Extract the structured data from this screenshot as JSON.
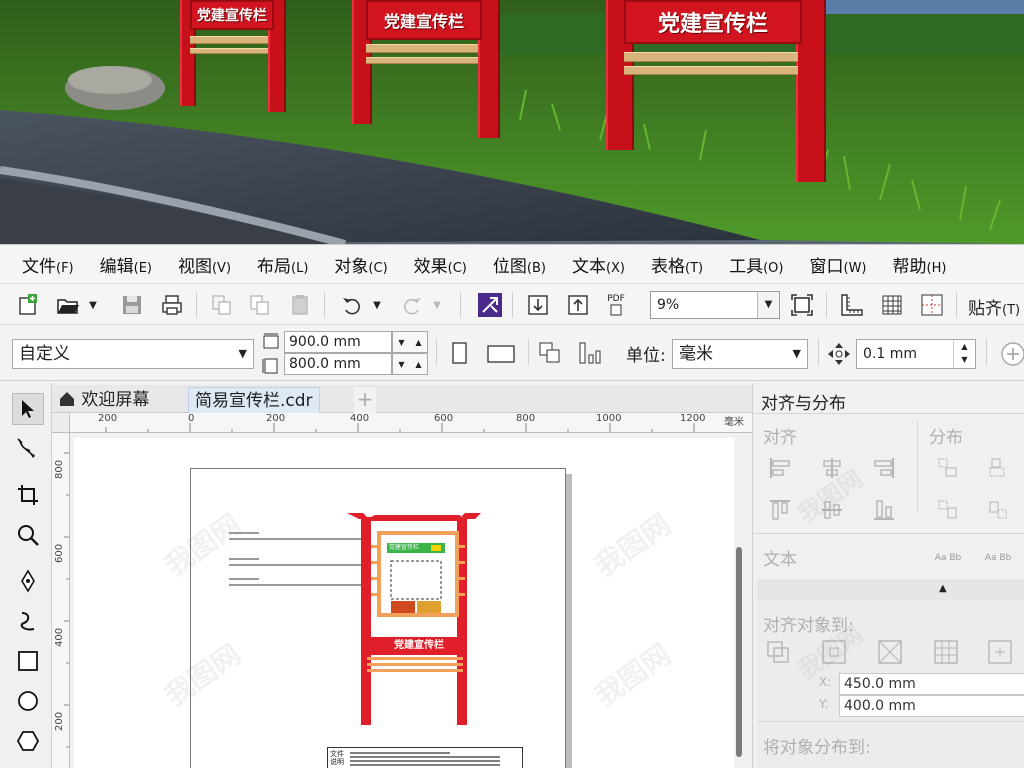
{
  "scene": {
    "signs": [
      {
        "label": "党建宣传栏"
      },
      {
        "label": "党建宣传栏"
      },
      {
        "label": "党建宣传栏"
      }
    ]
  },
  "menubar": {
    "items": [
      {
        "label": "文件",
        "accel": "(F)"
      },
      {
        "label": "编辑",
        "accel": "(E)"
      },
      {
        "label": "视图",
        "accel": "(V)"
      },
      {
        "label": "布局",
        "accel": "(L)"
      },
      {
        "label": "对象",
        "accel": "(C)"
      },
      {
        "label": "效果",
        "accel": "(C)"
      },
      {
        "label": "位图",
        "accel": "(B)"
      },
      {
        "label": "文本",
        "accel": "(X)"
      },
      {
        "label": "表格",
        "accel": "(T)"
      },
      {
        "label": "工具",
        "accel": "(O)"
      },
      {
        "label": "窗口",
        "accel": "(W)"
      },
      {
        "label": "帮助",
        "accel": "(H)"
      }
    ]
  },
  "toolbar": {
    "zoom": "9%",
    "snap_label": "贴齐",
    "snap_accel": "(T)",
    "pdf_label": "PDF"
  },
  "propbar": {
    "preset": "自定义",
    "width": "900.0 mm",
    "height": "800.0 mm",
    "unit_label": "单位:",
    "unit_value": "毫米",
    "nudge": "0.1 mm"
  },
  "tabs": {
    "welcome": "欢迎屏幕",
    "document": "简易宣传栏.cdr",
    "add": "+"
  },
  "ruler": {
    "h_ticks": [
      "200",
      "0",
      "200",
      "400",
      "600",
      "800",
      "1000",
      "1200"
    ],
    "h_unit": "毫米",
    "v_ticks": [
      "800",
      "600",
      "400",
      "200"
    ]
  },
  "canvas": {
    "sign_caption": "党建宣传栏",
    "sign_header": "党建宣传栏",
    "note_title": "文件说明"
  },
  "docker": {
    "title": "对齐与分布",
    "align": "对齐",
    "distribute": "分布",
    "text": "文本",
    "text_icon": "Aa Bb",
    "align_to": "对齐对象到:",
    "x_label": "X:",
    "x_value": "450.0 mm",
    "y_label": "Y:",
    "y_value": "400.0 mm",
    "distribute_to": "将对象分布到:"
  },
  "watermark": "我图网",
  "colors": {
    "brand_red": "#d11420",
    "sign_wood": "#d9b47a",
    "accent_orange": "#f2a05a"
  }
}
